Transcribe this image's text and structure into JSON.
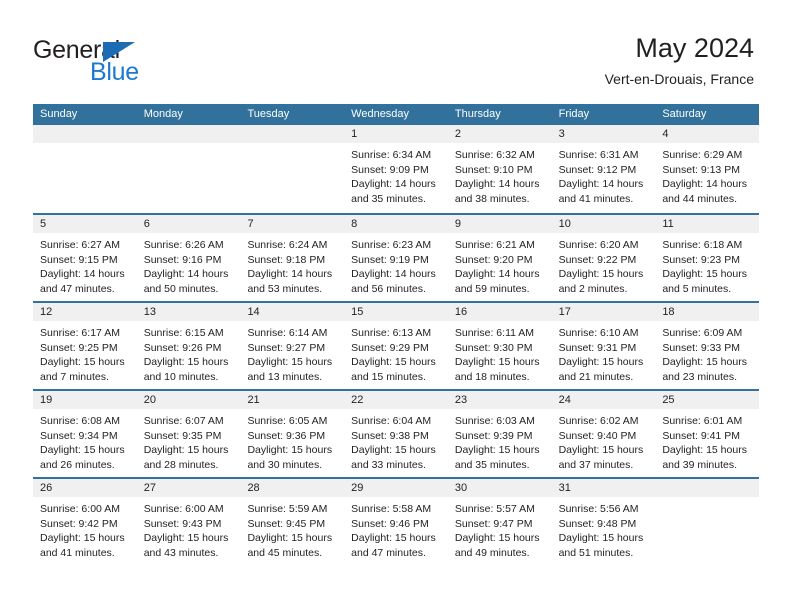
{
  "brand": {
    "word1": "General",
    "word2": "Blue",
    "accent_color": "#1b7ad0",
    "triangle_color": "#1b6cb5"
  },
  "header": {
    "title": "May 2024",
    "subtitle": "Vert-en-Drouais, France",
    "header_bg": "#31719b",
    "day_band_bg": "#f0f0f0"
  },
  "weekdays": [
    "Sunday",
    "Monday",
    "Tuesday",
    "Wednesday",
    "Thursday",
    "Friday",
    "Saturday"
  ],
  "weeks": [
    [
      {
        "day": "",
        "lines": []
      },
      {
        "day": "",
        "lines": []
      },
      {
        "day": "",
        "lines": []
      },
      {
        "day": "1",
        "lines": [
          "Sunrise: 6:34 AM",
          "Sunset: 9:09 PM",
          "Daylight: 14 hours",
          "and 35 minutes."
        ]
      },
      {
        "day": "2",
        "lines": [
          "Sunrise: 6:32 AM",
          "Sunset: 9:10 PM",
          "Daylight: 14 hours",
          "and 38 minutes."
        ]
      },
      {
        "day": "3",
        "lines": [
          "Sunrise: 6:31 AM",
          "Sunset: 9:12 PM",
          "Daylight: 14 hours",
          "and 41 minutes."
        ]
      },
      {
        "day": "4",
        "lines": [
          "Sunrise: 6:29 AM",
          "Sunset: 9:13 PM",
          "Daylight: 14 hours",
          "and 44 minutes."
        ]
      }
    ],
    [
      {
        "day": "5",
        "lines": [
          "Sunrise: 6:27 AM",
          "Sunset: 9:15 PM",
          "Daylight: 14 hours",
          "and 47 minutes."
        ]
      },
      {
        "day": "6",
        "lines": [
          "Sunrise: 6:26 AM",
          "Sunset: 9:16 PM",
          "Daylight: 14 hours",
          "and 50 minutes."
        ]
      },
      {
        "day": "7",
        "lines": [
          "Sunrise: 6:24 AM",
          "Sunset: 9:18 PM",
          "Daylight: 14 hours",
          "and 53 minutes."
        ]
      },
      {
        "day": "8",
        "lines": [
          "Sunrise: 6:23 AM",
          "Sunset: 9:19 PM",
          "Daylight: 14 hours",
          "and 56 minutes."
        ]
      },
      {
        "day": "9",
        "lines": [
          "Sunrise: 6:21 AM",
          "Sunset: 9:20 PM",
          "Daylight: 14 hours",
          "and 59 minutes."
        ]
      },
      {
        "day": "10",
        "lines": [
          "Sunrise: 6:20 AM",
          "Sunset: 9:22 PM",
          "Daylight: 15 hours",
          "and 2 minutes."
        ]
      },
      {
        "day": "11",
        "lines": [
          "Sunrise: 6:18 AM",
          "Sunset: 9:23 PM",
          "Daylight: 15 hours",
          "and 5 minutes."
        ]
      }
    ],
    [
      {
        "day": "12",
        "lines": [
          "Sunrise: 6:17 AM",
          "Sunset: 9:25 PM",
          "Daylight: 15 hours",
          "and 7 minutes."
        ]
      },
      {
        "day": "13",
        "lines": [
          "Sunrise: 6:15 AM",
          "Sunset: 9:26 PM",
          "Daylight: 15 hours",
          "and 10 minutes."
        ]
      },
      {
        "day": "14",
        "lines": [
          "Sunrise: 6:14 AM",
          "Sunset: 9:27 PM",
          "Daylight: 15 hours",
          "and 13 minutes."
        ]
      },
      {
        "day": "15",
        "lines": [
          "Sunrise: 6:13 AM",
          "Sunset: 9:29 PM",
          "Daylight: 15 hours",
          "and 15 minutes."
        ]
      },
      {
        "day": "16",
        "lines": [
          "Sunrise: 6:11 AM",
          "Sunset: 9:30 PM",
          "Daylight: 15 hours",
          "and 18 minutes."
        ]
      },
      {
        "day": "17",
        "lines": [
          "Sunrise: 6:10 AM",
          "Sunset: 9:31 PM",
          "Daylight: 15 hours",
          "and 21 minutes."
        ]
      },
      {
        "day": "18",
        "lines": [
          "Sunrise: 6:09 AM",
          "Sunset: 9:33 PM",
          "Daylight: 15 hours",
          "and 23 minutes."
        ]
      }
    ],
    [
      {
        "day": "19",
        "lines": [
          "Sunrise: 6:08 AM",
          "Sunset: 9:34 PM",
          "Daylight: 15 hours",
          "and 26 minutes."
        ]
      },
      {
        "day": "20",
        "lines": [
          "Sunrise: 6:07 AM",
          "Sunset: 9:35 PM",
          "Daylight: 15 hours",
          "and 28 minutes."
        ]
      },
      {
        "day": "21",
        "lines": [
          "Sunrise: 6:05 AM",
          "Sunset: 9:36 PM",
          "Daylight: 15 hours",
          "and 30 minutes."
        ]
      },
      {
        "day": "22",
        "lines": [
          "Sunrise: 6:04 AM",
          "Sunset: 9:38 PM",
          "Daylight: 15 hours",
          "and 33 minutes."
        ]
      },
      {
        "day": "23",
        "lines": [
          "Sunrise: 6:03 AM",
          "Sunset: 9:39 PM",
          "Daylight: 15 hours",
          "and 35 minutes."
        ]
      },
      {
        "day": "24",
        "lines": [
          "Sunrise: 6:02 AM",
          "Sunset: 9:40 PM",
          "Daylight: 15 hours",
          "and 37 minutes."
        ]
      },
      {
        "day": "25",
        "lines": [
          "Sunrise: 6:01 AM",
          "Sunset: 9:41 PM",
          "Daylight: 15 hours",
          "and 39 minutes."
        ]
      }
    ],
    [
      {
        "day": "26",
        "lines": [
          "Sunrise: 6:00 AM",
          "Sunset: 9:42 PM",
          "Daylight: 15 hours",
          "and 41 minutes."
        ]
      },
      {
        "day": "27",
        "lines": [
          "Sunrise: 6:00 AM",
          "Sunset: 9:43 PM",
          "Daylight: 15 hours",
          "and 43 minutes."
        ]
      },
      {
        "day": "28",
        "lines": [
          "Sunrise: 5:59 AM",
          "Sunset: 9:45 PM",
          "Daylight: 15 hours",
          "and 45 minutes."
        ]
      },
      {
        "day": "29",
        "lines": [
          "Sunrise: 5:58 AM",
          "Sunset: 9:46 PM",
          "Daylight: 15 hours",
          "and 47 minutes."
        ]
      },
      {
        "day": "30",
        "lines": [
          "Sunrise: 5:57 AM",
          "Sunset: 9:47 PM",
          "Daylight: 15 hours",
          "and 49 minutes."
        ]
      },
      {
        "day": "31",
        "lines": [
          "Sunrise: 5:56 AM",
          "Sunset: 9:48 PM",
          "Daylight: 15 hours",
          "and 51 minutes."
        ]
      },
      {
        "day": "",
        "lines": []
      }
    ]
  ]
}
